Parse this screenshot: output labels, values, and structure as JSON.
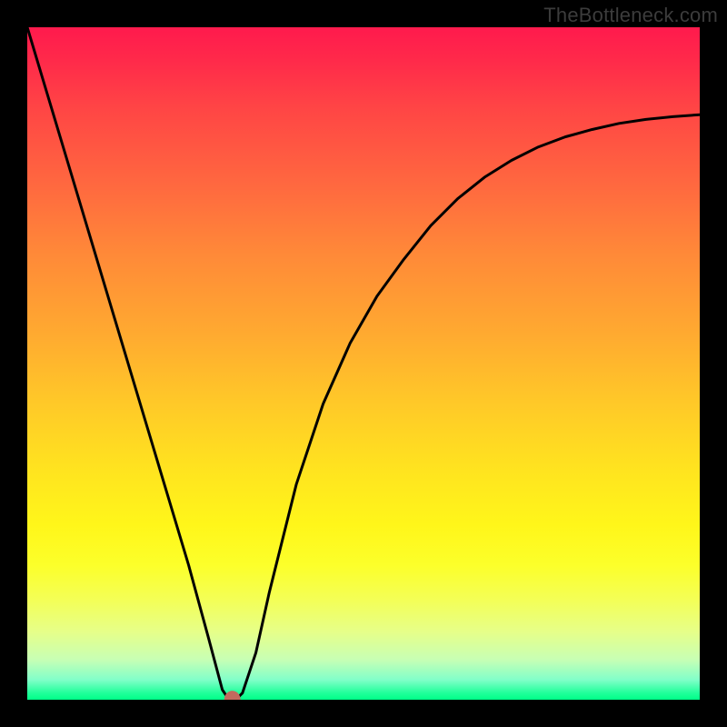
{
  "watermark": "TheBottleneck.com",
  "chart_data": {
    "type": "line",
    "title": "",
    "xlabel": "",
    "ylabel": "",
    "xlim": [
      0,
      1
    ],
    "ylim": [
      0,
      1
    ],
    "grid": false,
    "legend": false,
    "series": [
      {
        "name": "bottleneck-curve",
        "kind": "line",
        "x": [
          0.0,
          0.03,
          0.06,
          0.09,
          0.12,
          0.15,
          0.18,
          0.21,
          0.24,
          0.27,
          0.29,
          0.3,
          0.31,
          0.32,
          0.34,
          0.36,
          0.4,
          0.44,
          0.48,
          0.52,
          0.56,
          0.6,
          0.64,
          0.68,
          0.72,
          0.76,
          0.8,
          0.84,
          0.88,
          0.92,
          0.96,
          1.0
        ],
        "y": [
          1.0,
          0.9,
          0.8,
          0.7,
          0.6,
          0.5,
          0.4,
          0.3,
          0.2,
          0.09,
          0.015,
          0.0,
          0.0,
          0.01,
          0.07,
          0.16,
          0.32,
          0.44,
          0.53,
          0.6,
          0.655,
          0.705,
          0.745,
          0.777,
          0.802,
          0.822,
          0.837,
          0.848,
          0.857,
          0.863,
          0.867,
          0.87
        ]
      },
      {
        "name": "optimum-point",
        "kind": "marker",
        "x": [
          0.305
        ],
        "y": [
          0.0
        ],
        "color": "#c26a5e",
        "radius_px": 9
      }
    ]
  }
}
